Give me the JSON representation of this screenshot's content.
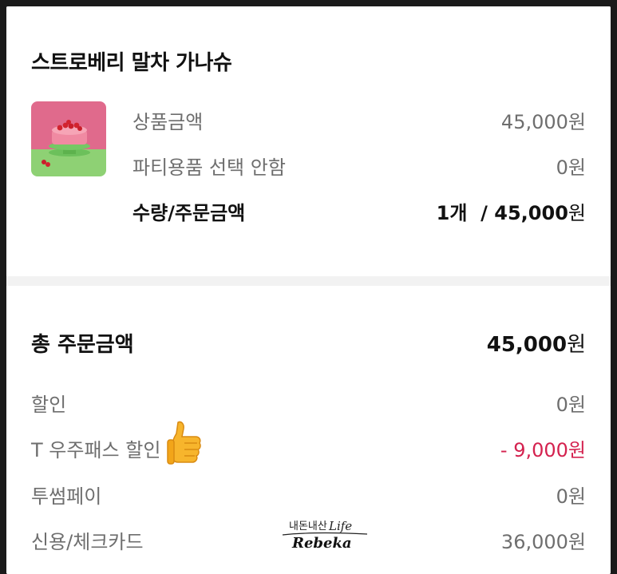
{
  "product": {
    "title": "스트로베리 말차 가나슈",
    "rows": [
      {
        "label": "상품금액",
        "value": "45,000",
        "unit": "원"
      },
      {
        "label": "파티용품 선택 안함",
        "value": "0",
        "unit": "원"
      }
    ],
    "qty_row": {
      "label": "수량/주문금액",
      "qty": "1개",
      "separator": "/",
      "value": "45,000",
      "unit": "원"
    }
  },
  "summary": {
    "total": {
      "label": "총 주문금액",
      "value": "45,000",
      "unit": "원"
    },
    "rows": [
      {
        "label": "할인",
        "value": "0",
        "unit": "원"
      },
      {
        "label": "T 우주패스 할인",
        "value": "- 9,000",
        "unit": "원"
      },
      {
        "label": "투썸페이",
        "value": "0",
        "unit": "원"
      },
      {
        "label": "신용/체크카드",
        "value": "36,000",
        "unit": "원"
      }
    ]
  },
  "watermark": {
    "top": "내돈내산",
    "life": "Life",
    "main": "Rebeka"
  },
  "colors": {
    "discount_red": "#d4224f",
    "text_dark": "#111111",
    "text_gray": "#6e6e6e",
    "band": "#f2f2f2"
  },
  "icons": {
    "thumbs_up": "thumbs-up-icon",
    "product_image": "strawberry-cake-image"
  }
}
